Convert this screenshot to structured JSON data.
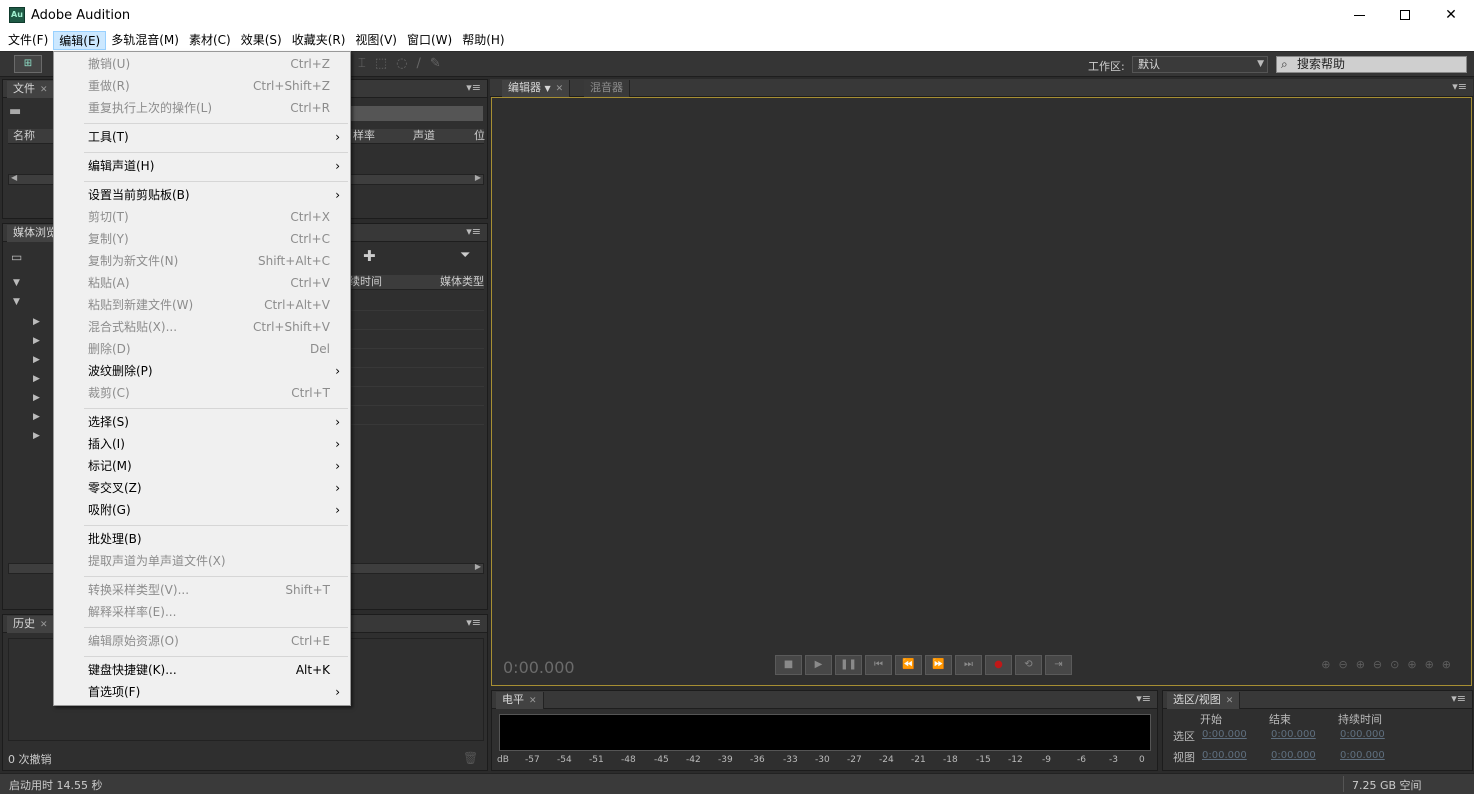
{
  "window": {
    "app_icon": "Au",
    "title": "Adobe Audition",
    "controls": {
      "close": "✕"
    }
  },
  "menubar": [
    "文件(F)",
    "编辑(E)",
    "多轨混音(M)",
    "素材(C)",
    "效果(S)",
    "收藏夹(R)",
    "视图(V)",
    "窗口(W)",
    "帮助(H)"
  ],
  "toolbar": {
    "button_glyph": "⊞",
    "workspace_label": "工作区:",
    "workspace_value": "默认",
    "help_placeholder": "搜索帮助"
  },
  "files_panel": {
    "tab": "文件",
    "columns": [
      "名称",
      "样率",
      "声道",
      "位"
    ]
  },
  "media_panel": {
    "tab": "媒体浏览",
    "columns": [
      "续时间",
      "媒体类型"
    ]
  },
  "history_panel": {
    "tab": "历史",
    "status": "0 次撤销"
  },
  "editor": {
    "tabs": [
      "编辑器",
      "混音器"
    ],
    "timecode": "0:00.000"
  },
  "levels_panel": {
    "tab": "电平",
    "scale": [
      "dB",
      "-57",
      "-54",
      "-51",
      "-48",
      "-45",
      "-42",
      "-39",
      "-36",
      "-33",
      "-30",
      "-27",
      "-24",
      "-21",
      "-18",
      "-15",
      "-12",
      "-9",
      "-6",
      "-3",
      "0"
    ]
  },
  "selection_panel": {
    "tab": "选区/视图",
    "headers": [
      "开始",
      "结束",
      "持续时间"
    ],
    "rows": [
      {
        "label": "选区",
        "start": "0:00.000",
        "end": "0:00.000",
        "duration": "0:00.000"
      },
      {
        "label": "视图",
        "start": "0:00.000",
        "end": "0:00.000",
        "duration": "0:00.000"
      }
    ]
  },
  "statusbar": {
    "left": "启动用时 14.55 秒",
    "right": "7.25 GB 空间"
  },
  "edit_menu": {
    "items": [
      {
        "label": "撤销(U)",
        "shortcut": "Ctrl+Z",
        "disabled": true
      },
      {
        "label": "重做(R)",
        "shortcut": "Ctrl+Shift+Z",
        "disabled": true
      },
      {
        "label": "重复执行上次的操作(L)",
        "shortcut": "Ctrl+R",
        "disabled": true
      },
      {
        "label": "工具(T)",
        "shortcut": "",
        "disabled": false,
        "submenu": true
      },
      {
        "label": "编辑声道(H)",
        "shortcut": "",
        "disabled": false,
        "submenu": true
      },
      {
        "label": "设置当前剪贴板(B)",
        "shortcut": "",
        "disabled": false,
        "submenu": true
      },
      {
        "label": "剪切(T)",
        "shortcut": "Ctrl+X",
        "disabled": true
      },
      {
        "label": "复制(Y)",
        "shortcut": "Ctrl+C",
        "disabled": true
      },
      {
        "label": "复制为新文件(N)",
        "shortcut": "Shift+Alt+C",
        "disabled": true
      },
      {
        "label": "粘贴(A)",
        "shortcut": "Ctrl+V",
        "disabled": true
      },
      {
        "label": "粘贴到新建文件(W)",
        "shortcut": "Ctrl+Alt+V",
        "disabled": true
      },
      {
        "label": "混合式粘贴(X)...",
        "shortcut": "Ctrl+Shift+V",
        "disabled": true
      },
      {
        "label": "删除(D)",
        "shortcut": "Del",
        "disabled": true
      },
      {
        "label": "波纹删除(P)",
        "shortcut": "",
        "disabled": false,
        "submenu": true
      },
      {
        "label": "裁剪(C)",
        "shortcut": "Ctrl+T",
        "disabled": true
      },
      {
        "label": "选择(S)",
        "shortcut": "",
        "disabled": false,
        "submenu": true
      },
      {
        "label": "插入(I)",
        "shortcut": "",
        "disabled": false,
        "submenu": true
      },
      {
        "label": "标记(M)",
        "shortcut": "",
        "disabled": false,
        "submenu": true
      },
      {
        "label": "零交叉(Z)",
        "shortcut": "",
        "disabled": false,
        "submenu": true
      },
      {
        "label": "吸附(G)",
        "shortcut": "",
        "disabled": false,
        "submenu": true
      },
      {
        "label": "批处理(B)",
        "shortcut": "",
        "disabled": false
      },
      {
        "label": "提取声道为单声道文件(X)",
        "shortcut": "",
        "disabled": true
      },
      {
        "label": "转换采样类型(V)...",
        "shortcut": "Shift+T",
        "disabled": true
      },
      {
        "label": "解释采样率(E)...",
        "shortcut": "",
        "disabled": true
      },
      {
        "label": "编辑原始资源(O)",
        "shortcut": "Ctrl+E",
        "disabled": true
      },
      {
        "label": "键盘快捷键(K)...",
        "shortcut": "Alt+K",
        "disabled": false
      },
      {
        "label": "首选项(F)",
        "shortcut": "",
        "disabled": false,
        "submenu": true
      }
    ]
  },
  "colors": {
    "panel_bg": "#2f2f2f",
    "editor_border": "#a78f33",
    "menu_bg": "#f0f0f0",
    "menubar_active": "#cce8ff"
  }
}
